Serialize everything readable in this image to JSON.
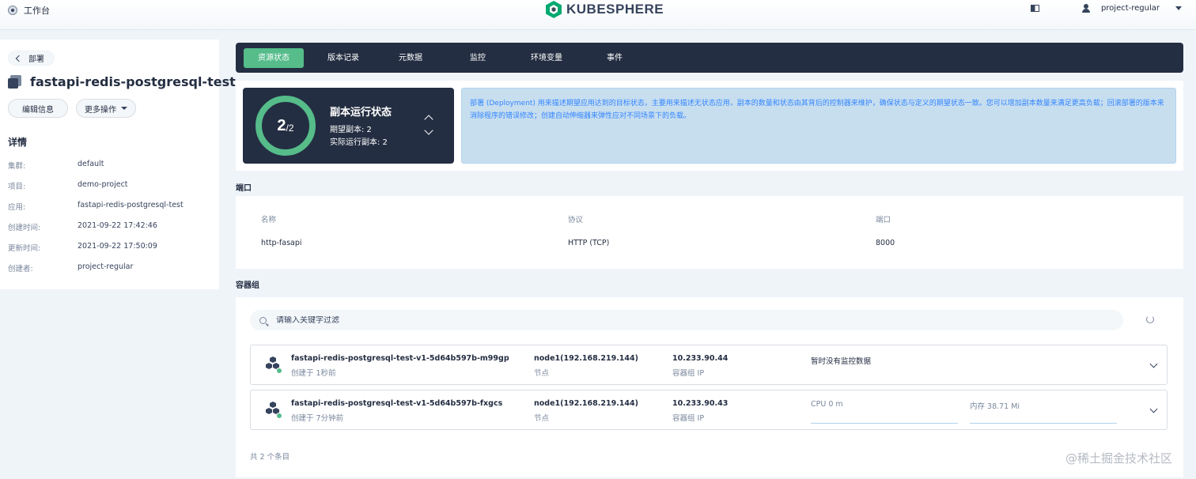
{
  "header": {
    "workbench": "工作台",
    "logo_text": "KUBESPHERE",
    "user": "project-regular"
  },
  "sidebar": {
    "back_label": "部署",
    "title": "fastapi-redis-postgresql-test-...",
    "edit_button": "编辑信息",
    "more_button": "更多操作",
    "details_title": "详情",
    "details": [
      {
        "key": "集群:",
        "value": "default"
      },
      {
        "key": "项目:",
        "value": "demo-project"
      },
      {
        "key": "应用:",
        "value": "fastapi-redis-postgresql-test"
      },
      {
        "key": "创建时间:",
        "value": "2021-09-22 17:42:46"
      },
      {
        "key": "更新时间:",
        "value": "2021-09-22 17:50:09"
      },
      {
        "key": "创建者:",
        "value": "project-regular"
      }
    ]
  },
  "tabs": [
    {
      "label": "资源状态",
      "active": true
    },
    {
      "label": "版本记录",
      "active": false
    },
    {
      "label": "元数据",
      "active": false
    },
    {
      "label": "监控",
      "active": false
    },
    {
      "label": "环境变量",
      "active": false
    },
    {
      "label": "事件",
      "active": false
    }
  ],
  "replica": {
    "current": "2",
    "total": "/2",
    "title": "副本运行状态",
    "desired": "期望副本: 2",
    "actual": "实际运行副本: 2"
  },
  "info_text": "部署 (Deployment) 用来描述期望应用达到的目标状态，主要用来描述无状态应用，副本的数量和状态由其背后的控制器来维护，确保状态与定义的期望状态一致。您可以增加副本数量来满足更高负载；回滚部署的版本来消除程序的错误修改；创建自动伸缩器来弹性应对不同场景下的负载。",
  "ports": {
    "section_title": "端口",
    "headers": [
      "名称",
      "协议",
      "端口"
    ],
    "rows": [
      [
        "http-fasapi",
        "HTTP (TCP)",
        "8000"
      ]
    ]
  },
  "pods": {
    "section_title": "容器组",
    "search_placeholder": "请输入关键字过滤",
    "items": [
      {
        "name": "fastapi-redis-postgresql-test-v1-5d64b597b-m99gp",
        "created": "创建于 1秒前",
        "node": "node1(192.168.219.144)",
        "node_label": "节点",
        "ip": "10.233.90.44",
        "ip_label": "容器组 IP",
        "monitor": "暂时没有监控数据"
      },
      {
        "name": "fastapi-redis-postgresql-test-v1-5d64b597b-fxgcs",
        "created": "创建于 7分钟前",
        "node": "node1(192.168.219.144)",
        "node_label": "节点",
        "ip": "10.233.90.43",
        "ip_label": "容器组 IP",
        "cpu": "CPU 0 m",
        "memory": "内存 38.71 Mi"
      }
    ],
    "total": "共 2 个条目"
  },
  "watermark": "@稀土掘金技术社区",
  "colors": {
    "accent": "#55bc8a",
    "dark": "#242e42",
    "info_bg": "#c7deef",
    "info_text": "#3385ff"
  }
}
